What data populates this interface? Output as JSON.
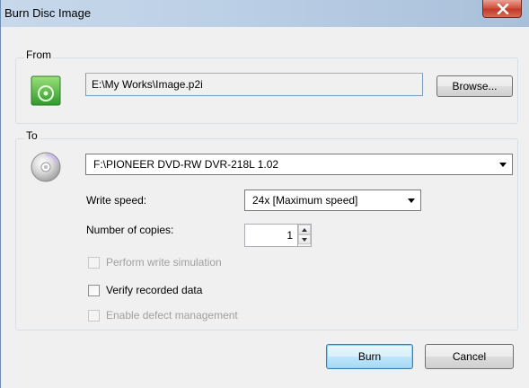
{
  "window": {
    "title": "Burn Disc Image",
    "close_label": "X"
  },
  "from_group": {
    "label": "From",
    "icon": "disc-image-file-icon",
    "path_value": "E:\\My Works\\Image.p2i",
    "browse_label": "Browse..."
  },
  "to_group": {
    "label": "To",
    "icon": "cd-disc-icon",
    "drive_value": "F:\\PIONEER DVD-RW  DVR-218L 1.02",
    "write_speed_label": "Write speed:",
    "write_speed_value": "24x [Maximum speed]",
    "copies_label": "Number of copies:",
    "copies_value": "1",
    "options": [
      {
        "label": "Perform write simulation",
        "checked": false,
        "enabled": false
      },
      {
        "label": "Verify recorded data",
        "checked": false,
        "enabled": true
      },
      {
        "label": "Enable defect management",
        "checked": false,
        "enabled": false
      }
    ]
  },
  "buttons": {
    "burn_label": "Burn",
    "cancel_label": "Cancel"
  },
  "colors": {
    "title_bar": "#bcd0e6",
    "close_button": "#c0392b",
    "dialog_bg": "#f0f0f0",
    "default_button_border": "#3c7fb1"
  }
}
